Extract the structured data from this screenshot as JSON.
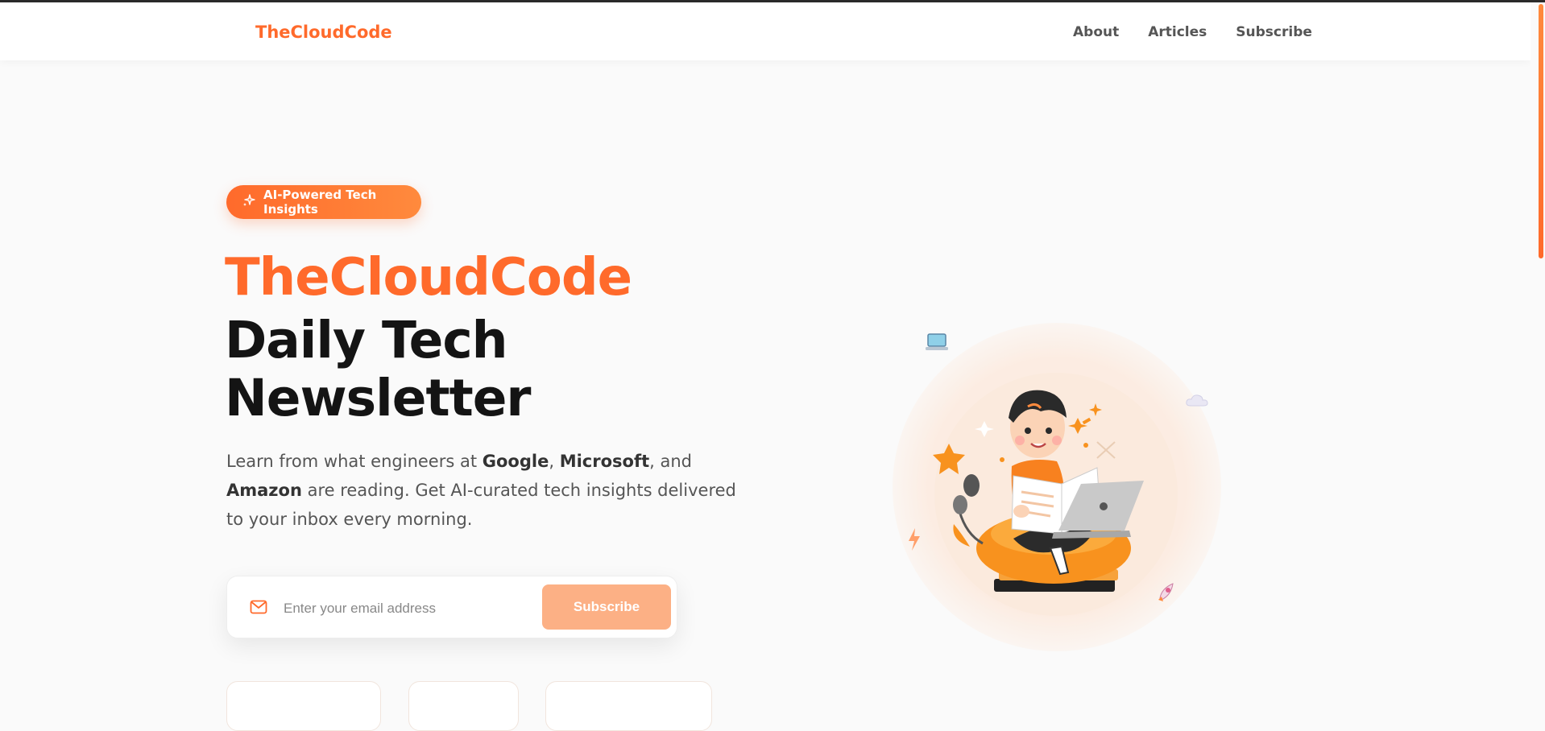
{
  "header": {
    "brand": "TheCloudCode",
    "nav": [
      "About",
      "Articles",
      "Subscribe"
    ]
  },
  "hero": {
    "badge": "AI-Powered Tech Insights",
    "title_brand": "TheCloudCode",
    "title_main": "Daily Tech Newsletter",
    "desc_prefix": "Learn from what engineers at ",
    "company_1": "Google",
    "sep_1": ", ",
    "company_2": "Microsoft",
    "sep_2": ", and ",
    "company_3": "Amazon",
    "desc_suffix": " are reading. Get AI-curated tech insights delivered to your inbox every morning."
  },
  "signup": {
    "placeholder": "Enter your email address",
    "button": "Subscribe"
  },
  "colors": {
    "accent": "#ff6a2b",
    "button_light": "#fcb085",
    "heading": "#141414"
  },
  "icons": [
    "sparkles-icon",
    "mail-icon",
    "laptop-icon",
    "cloud-icon",
    "lightning-icon",
    "rocket-icon"
  ]
}
